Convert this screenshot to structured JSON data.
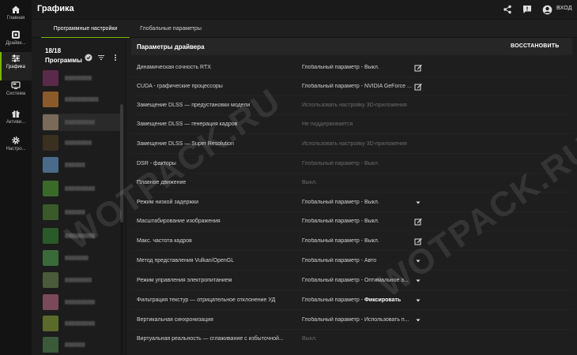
{
  "app": {
    "title": "Графика",
    "login": "ВХОД"
  },
  "nav": [
    {
      "label": "Главная",
      "icon": "home-icon"
    },
    {
      "label": "Драйве...",
      "icon": "driver-icon"
    },
    {
      "label": "Графика",
      "icon": "sliders-icon",
      "active": true
    },
    {
      "label": "Система",
      "icon": "monitor-icon"
    },
    {
      "label": "Активи...",
      "icon": "gift-icon"
    },
    {
      "label": "Настро...",
      "icon": "gear-icon"
    }
  ],
  "tabs": [
    {
      "label": "Программные настройки",
      "active": true
    },
    {
      "label": "Глобальные параметры"
    }
  ],
  "programs": {
    "count": "18/18",
    "label": "Программы"
  },
  "section": {
    "title": "Параметры драйвера",
    "restore": "ВОССТАНОВИТЬ"
  },
  "settings": [
    {
      "name": "Динамическая сочность RTX",
      "value": "Глобальный параметр - Выкл.",
      "control": "edit"
    },
    {
      "name": "CUDA - графические процессоры",
      "value": "Глобальный параметр - NVIDIA GeForce ...",
      "control": "edit"
    },
    {
      "name": "Замещение DLSS — предустановки модели",
      "value": "Использовать настройку 3D-приложения",
      "dim": true
    },
    {
      "name": "Замещение DLSS — генерация кадров",
      "value": "Не поддерживается",
      "dim": true
    },
    {
      "name": "Замещение DLSS — Super Resolution",
      "value": "Использовать настройку 3D-приложения",
      "dim": true
    },
    {
      "name": "DSR - факторы",
      "value": "Глобальный параметр - Выкл.",
      "dim": true
    },
    {
      "name": "Плавное движение",
      "value": "Выкл.",
      "dim": true
    },
    {
      "name": "Режим низкой задержки",
      "value": "Глобальный параметр - Выкл.",
      "control": "dropdown"
    },
    {
      "name": "Масштабирование изображения",
      "value": "Глобальный параметр - Выкл.",
      "control": "edit"
    },
    {
      "name": "Макс. частота кадров",
      "value": "Глобальный параметр - Выкл.",
      "control": "edit"
    },
    {
      "name": "Метод представления Vulkan/OpenGL",
      "value": "Глобальный параметр - Авто",
      "control": "dropdown"
    },
    {
      "name": "Режим управления электропитанием",
      "value": "Глобальный параметр - Оптимальное э...",
      "control": "dropdown"
    },
    {
      "name": "Фильтрация текстур — отрицательное отклонение УД",
      "value_prefix": "Глобальный параметр - ",
      "value_bold": "Фиксировать",
      "control": "dropdown"
    },
    {
      "name": "Вертикальная синхронизация",
      "value": "Глобальный параметр - Использовать п...",
      "control": "dropdown"
    },
    {
      "name": "Виртуальная реальность — сглаживание с избыточной...",
      "value": "Выкл.",
      "dim": true
    }
  ],
  "watermark": "WOTPACK.RU",
  "colors": {
    "accent": "#76b900",
    "background": "#1e1e1e",
    "rail": "#131313"
  }
}
